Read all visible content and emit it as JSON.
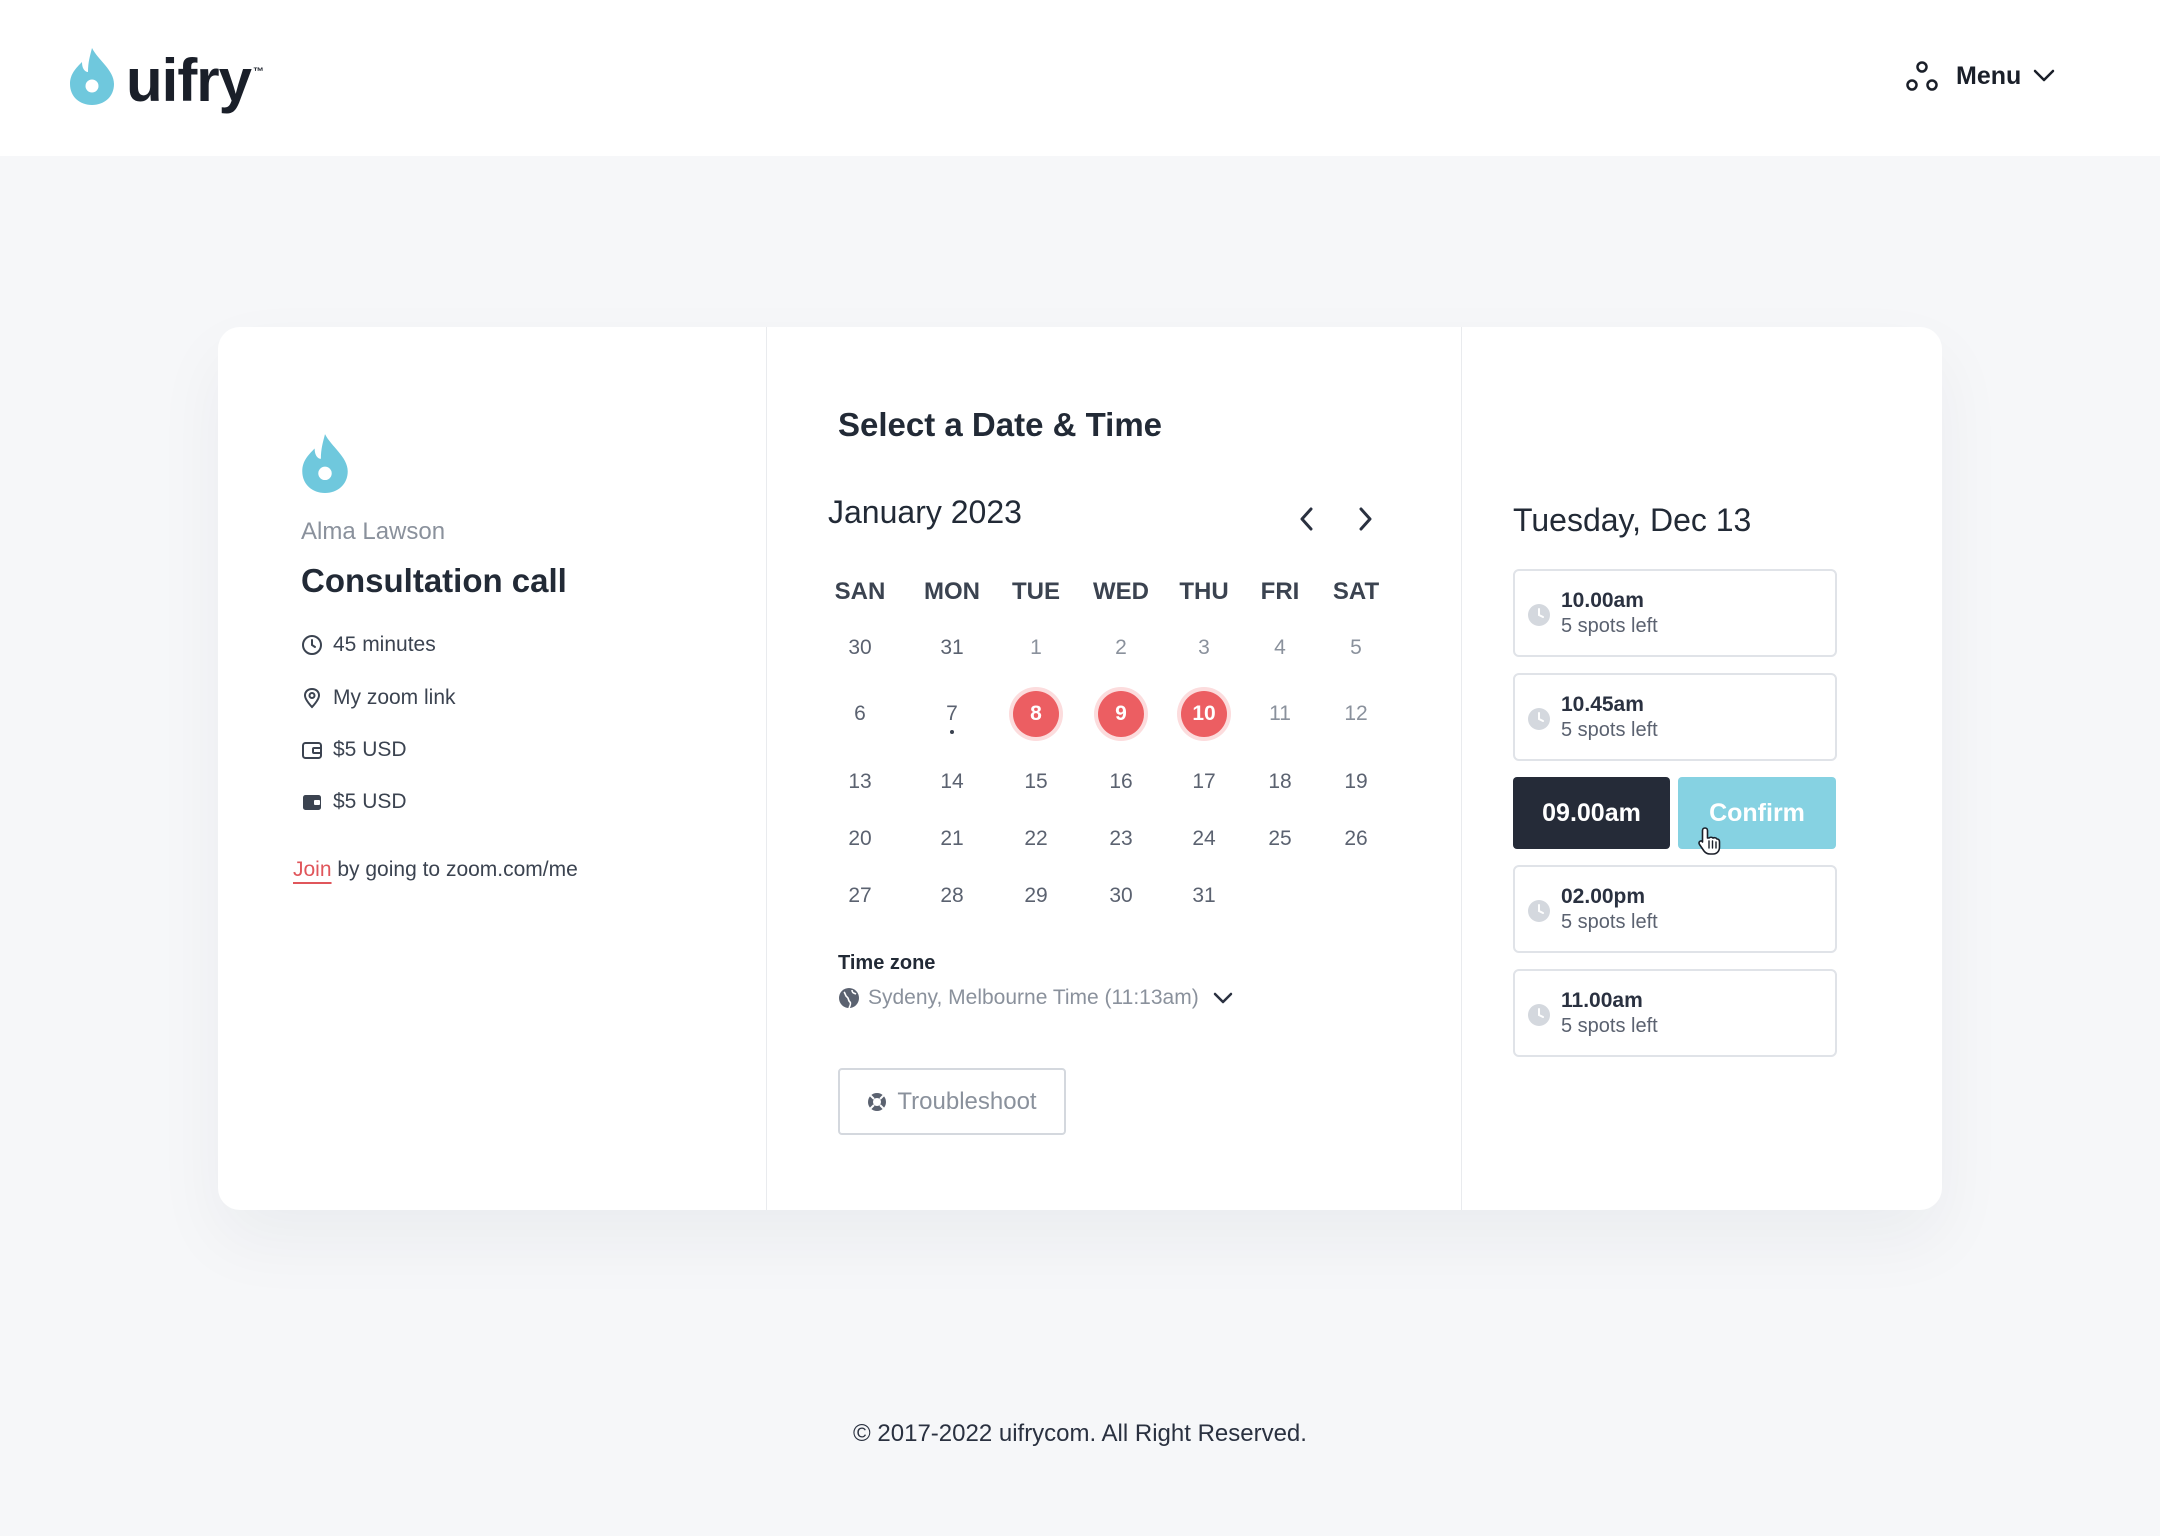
{
  "header": {
    "logo_text": "uifry",
    "logo_tm": "™",
    "menu_label": "Menu"
  },
  "colors": {
    "accent_teal": "#6fc8dd",
    "available_red": "#ec5e62",
    "dark": "#252b38",
    "confirm": "#86d2e2"
  },
  "event": {
    "host": "Alma Lawson",
    "title": "Consultation call",
    "duration": "45 minutes",
    "location": "My zoom link",
    "price_1": "$5 USD",
    "price_2": "$5 USD",
    "join_link": "Join",
    "join_suffix": " by going to zoom.com/me"
  },
  "calendar": {
    "section_title": "Select a Date & Time",
    "month": "January 2023",
    "weekdays": [
      "SAN",
      "MON",
      "TUE",
      "WED",
      "THU",
      "FRI",
      "SAT"
    ],
    "days": [
      [
        "30",
        "31",
        "1",
        "2",
        "3",
        "4",
        "5"
      ],
      [
        "6",
        "7",
        "8",
        "9",
        "10",
        "11",
        "12"
      ],
      [
        "13",
        "14",
        "15",
        "16",
        "17",
        "18",
        "19"
      ],
      [
        "20",
        "21",
        "22",
        "23",
        "24",
        "25",
        "26"
      ],
      [
        "27",
        "28",
        "29",
        "30",
        "31"
      ]
    ],
    "available_days": [
      "8",
      "9",
      "10"
    ],
    "today": "7"
  },
  "timezone": {
    "label": "Time zone",
    "value": "Sydeny, Melbourne Time (11:13am)"
  },
  "troubleshoot_label": "Troubleshoot",
  "slots": {
    "day_heading": "Tuesday, Dec 13",
    "items": [
      {
        "time": "10.00am",
        "spots": "5 spots left"
      },
      {
        "time": "10.45am",
        "spots": "5 spots left"
      },
      {
        "time": "02.00pm",
        "spots": "5 spots left"
      },
      {
        "time": "11.00am",
        "spots": "5 spots left"
      }
    ],
    "selected_time": "09.00am",
    "confirm_label": "Confirm"
  },
  "footer": {
    "copyright": "© 2017-2022  uifrycom. All Right Reserved."
  }
}
